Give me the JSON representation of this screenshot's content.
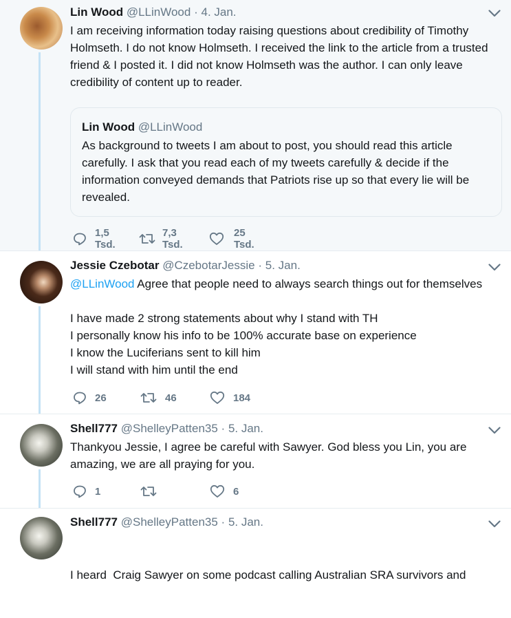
{
  "tweets": [
    {
      "name": "Lin Wood",
      "handle": "@LLinWood",
      "dot": "·",
      "date": "4. Jan.",
      "text": [
        "I am receiving information today raising questions about credibility of Timothy Holmseth. I do not know Holmseth. I received the link to the article from a trusted friend & I posted it. I did not know Holmseth was the author. I can only leave credibility of content up to reader."
      ],
      "quote": {
        "name": "Lin Wood",
        "handle": "@LLinWood",
        "text": "As background to tweets I am about to post, you should read this article carefully. I ask that you read each of my tweets carefully & decide if the information conveyed demands that Patriots rise up so that every lie will be revealed."
      },
      "replies": "1,5 Tsd.",
      "retweets": "7,3 Tsd.",
      "likes": "25 Tsd.",
      "icons": [
        "reply-icon",
        "retweet-icon",
        "like-icon",
        "chevron-down-icon"
      ]
    },
    {
      "name": "Jessie Czebotar",
      "handle": "@CzebotarJessie",
      "dot": "·",
      "date": "5. Jan.",
      "mention": "@LLinWood",
      "first_line": " Agree that people need to always search things out for themselves",
      "lines": [
        "I have made 2 strong statements about why I stand with TH",
        "I personally know his info to be 100% accurate base on experience",
        "I know the Luciferians sent to kill him",
        "I will stand with him until the end"
      ],
      "replies": "26",
      "retweets": "46",
      "likes": "184"
    },
    {
      "name": "Shell777",
      "handle": "@ShelleyPatten35",
      "dot": "·",
      "date": "5. Jan.",
      "text": [
        "Thankyou Jessie, I agree be careful with Sawyer. God bless you Lin, you are amazing, we are all praying for you."
      ],
      "replies": "1",
      "retweets": "",
      "likes": "6"
    },
    {
      "name": "Shell777",
      "handle": "@ShelleyPatten35",
      "dot": "·",
      "date": "5. Jan.",
      "text": [
        "I heard  Craig Sawyer on some podcast calling Australian SRA survivors and"
      ]
    }
  ],
  "colors": {
    "link": "#1da1f2",
    "muted": "#657786",
    "thread": "#c4e2f5"
  }
}
